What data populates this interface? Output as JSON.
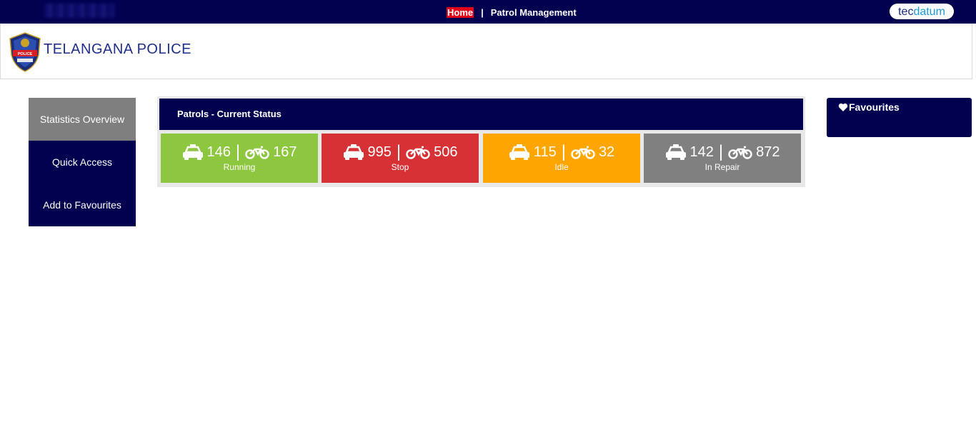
{
  "topbar": {
    "nav": [
      {
        "label": "Home"
      },
      {
        "label": "Patrol Management"
      }
    ],
    "separator": "|",
    "brand": {
      "part1": "tec",
      "part2": "datum"
    }
  },
  "header": {
    "title": "TELANGANA POLICE",
    "logo_text": "TELANGANA POLICE"
  },
  "sidebar": {
    "items": [
      {
        "label": "Statistics Overview",
        "active": true
      },
      {
        "label": "Quick Access",
        "active": false
      },
      {
        "label": "Add to Favourites",
        "active": false
      }
    ]
  },
  "status_panel": {
    "title": "Patrols - Current Status",
    "separator": "|",
    "tiles": [
      {
        "label": "Running",
        "cars": "146",
        "bikes": "167",
        "color": "#8dc63f"
      },
      {
        "label": "Stop",
        "cars": "995",
        "bikes": "506",
        "color": "#d63236"
      },
      {
        "label": "Idle",
        "cars": "115",
        "bikes": "32",
        "color": "#fea500"
      },
      {
        "label": "In Repair",
        "cars": "142",
        "bikes": "872",
        "color": "#808080"
      }
    ]
  },
  "favourites": {
    "title": "Favourites"
  },
  "icons": {
    "car": "car-icon",
    "bike": "motorcycle-icon",
    "heart": "heart-icon"
  }
}
